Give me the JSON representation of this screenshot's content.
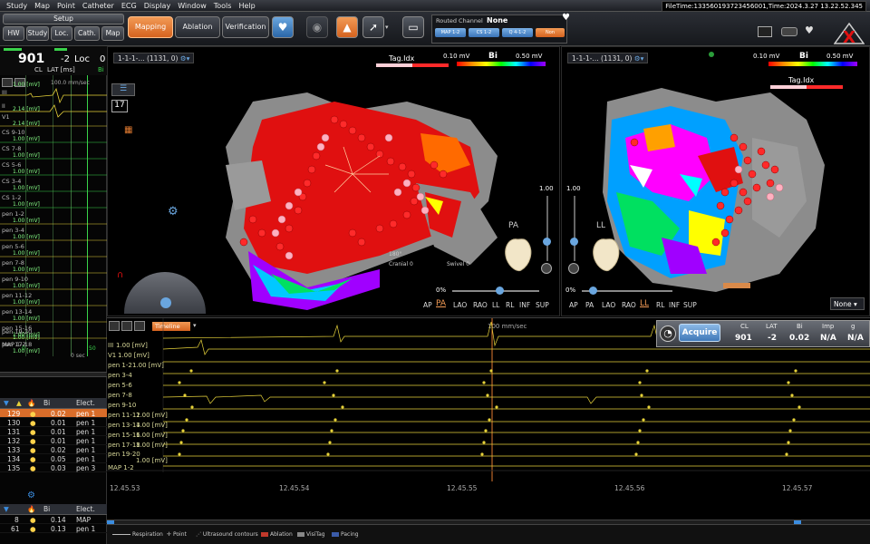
{
  "menu": [
    "Study",
    "Map",
    "Point",
    "Catheter",
    "ECG",
    "Display",
    "Window",
    "Tools",
    "Help"
  ],
  "filetime": "FileTime:133560193723456001,Time:2024.3.27 13.22.52.345",
  "toolbar": {
    "setup": "Setup",
    "small_buttons": [
      "HW",
      "Study",
      "Loc.",
      "Cath.",
      "Map"
    ],
    "mode_buttons": [
      "Mapping",
      "Ablation",
      "Verification"
    ],
    "routed_label": "Routed Channel",
    "routed_value": "None",
    "routed_chips": [
      "MAP 1-2",
      "CS 1-2",
      "Q 4-1-2",
      "Non"
    ]
  },
  "left": {
    "cl_value": "901",
    "lat_value": "-2",
    "loc_label": "Loc",
    "loc_value": "0",
    "cl_label": "CL",
    "lat_label": "LAT [ms]",
    "bi_label": "Bi",
    "speed": "100.0 mm/sec",
    "channels": [
      {
        "name": "III",
        "scale": "1.00 [mV]"
      },
      {
        "name": "II",
        "scale": "2.14 [mV]"
      },
      {
        "name": "V1",
        "scale": "2.14 [mV]"
      },
      {
        "name": "CS 9-10",
        "scale": "1.00 [mV]"
      },
      {
        "name": "CS 7-8",
        "scale": "1.00 [mV]"
      },
      {
        "name": "CS 5-6",
        "scale": "1.00 [mV]"
      },
      {
        "name": "CS 3-4",
        "scale": "1.00 [mV]"
      },
      {
        "name": "CS 1-2",
        "scale": "1.00 [mV]"
      },
      {
        "name": "pen 1-2",
        "scale": "1.00 [mV]"
      },
      {
        "name": "pen 3-4",
        "scale": "1.00 [mV]"
      },
      {
        "name": "pen 5-6",
        "scale": "1.00 [mV]"
      },
      {
        "name": "pen 7-8",
        "scale": "1.00 [mV]"
      },
      {
        "name": "pen 9-10",
        "scale": "1.00 [mV]"
      },
      {
        "name": "pen 11-12",
        "scale": "1.00 [mV]"
      },
      {
        "name": "pen 13-14",
        "scale": "1.00 [mV]"
      },
      {
        "name": "pen 15-16",
        "scale": "1.00 [mV]"
      },
      {
        "name": "pen 17-18",
        "scale": "1.00 [mV]"
      },
      {
        "name": "pen 19-20",
        "scale": "1.00 [mV]"
      },
      {
        "name": "MAP 1-2",
        "scale": ""
      }
    ],
    "time_marker_a": "0",
    "time_marker_b": "50",
    "time_marker_c": "0 sec"
  },
  "points_table": {
    "headers": [
      "Bi",
      "Elect."
    ],
    "rows": [
      {
        "id": "129",
        "bi": "0.02",
        "elect": "pen 1"
      },
      {
        "id": "130",
        "bi": "0.01",
        "elect": "pen 1"
      },
      {
        "id": "131",
        "bi": "0.01",
        "elect": "pen 1"
      },
      {
        "id": "132",
        "bi": "0.01",
        "elect": "pen 1"
      },
      {
        "id": "133",
        "bi": "0.02",
        "elect": "pen 1"
      },
      {
        "id": "134",
        "bi": "0.05",
        "elect": "pen 1"
      },
      {
        "id": "135",
        "bi": "0.03",
        "elect": "pen 3"
      }
    ]
  },
  "tags_table": {
    "headers": [
      "Bi",
      "Elect."
    ],
    "rows": [
      {
        "id": "8",
        "bi": "0.14",
        "elect": "MAP"
      },
      {
        "id": "61",
        "bi": "0.13",
        "elect": "pen 1"
      }
    ]
  },
  "map_left": {
    "title": "1-1-1-... (1131, 0)",
    "bi_min": "0.10 mV",
    "bi_label": "Bi",
    "bi_max": "0.50 mV",
    "tag_label": "Tag.Idx",
    "view_value": "PA",
    "counter": "17",
    "opacity": "1.00",
    "pct": "0%",
    "views": [
      "AP",
      "PA",
      "LAO",
      "RAO",
      "LL",
      "RL",
      "INF",
      "SUP"
    ],
    "active_view": "PA",
    "overlay_a": "Cranial 0",
    "overlay_b": "180°",
    "overlay_c": "Swivel 0"
  },
  "map_right": {
    "title": "1-1-1-... (1131, 0)",
    "bi_min": "0.10 mV",
    "bi_label": "Bi",
    "bi_max": "0.50 mV",
    "tag_label": "Tag.Idx",
    "view_value": "LL",
    "opacity": "1.00",
    "pct": "0%",
    "views": [
      "AP",
      "PA",
      "LAO",
      "RAO",
      "LL",
      "RL",
      "INF",
      "SUP"
    ],
    "active_view": "LL",
    "none_select": "None"
  },
  "signals": {
    "timeline_label": "Timeline",
    "speed": "100 mm/sec",
    "channels": [
      {
        "name": "III",
        "scale": "1.00 [mV]"
      },
      {
        "name": "V1",
        "scale": "1.00 [mV]"
      },
      {
        "name": "pen 1-2",
        "scale": "1.00 [mV]"
      },
      {
        "name": "pen 3-4",
        "scale": ""
      },
      {
        "name": "pen 5-6",
        "scale": ""
      },
      {
        "name": "pen 7-8",
        "scale": ""
      },
      {
        "name": "pen 9-10",
        "scale": ""
      },
      {
        "name": "pen 11-12",
        "scale": "1.00 [mV]"
      },
      {
        "name": "pen 13-14",
        "scale": "1.00 [mV]"
      },
      {
        "name": "pen 15-16",
        "scale": "1.00 [mV]"
      },
      {
        "name": "pen 17-18",
        "scale": "1.00 [mV]"
      },
      {
        "name": "pen 19-20",
        "scale": "1.00 [mV]"
      },
      {
        "name": "MAP 1-2",
        "scale": ""
      }
    ],
    "times": [
      "12.45.53",
      "12.45.54",
      "12.45.55",
      "12.45.56",
      "12.45.57"
    ]
  },
  "acquire": {
    "button": "Acquire",
    "headers": [
      "CL",
      "LAT",
      "Bi",
      "Imp",
      "g"
    ],
    "values": [
      "901",
      "-2",
      "0.02",
      "N/A",
      "N/A"
    ]
  },
  "legend": [
    {
      "label": "Respiration",
      "color": "#bbbbbb"
    },
    {
      "label": "Point",
      "color": "#bbbbbb"
    },
    {
      "label": "Ultrasound contours",
      "color": "#bbbbbb"
    },
    {
      "label": "Ablation",
      "color": "#c0392b"
    },
    {
      "label": "VisiTag",
      "color": "#888888"
    },
    {
      "label": "Pacing",
      "color": "#3b5ba8"
    }
  ],
  "colors": {
    "accent_orange": "#e07a30",
    "signal_yellow": "#e6d23a",
    "ecg_green": "#39d24a",
    "scar_red": "#e01010"
  }
}
